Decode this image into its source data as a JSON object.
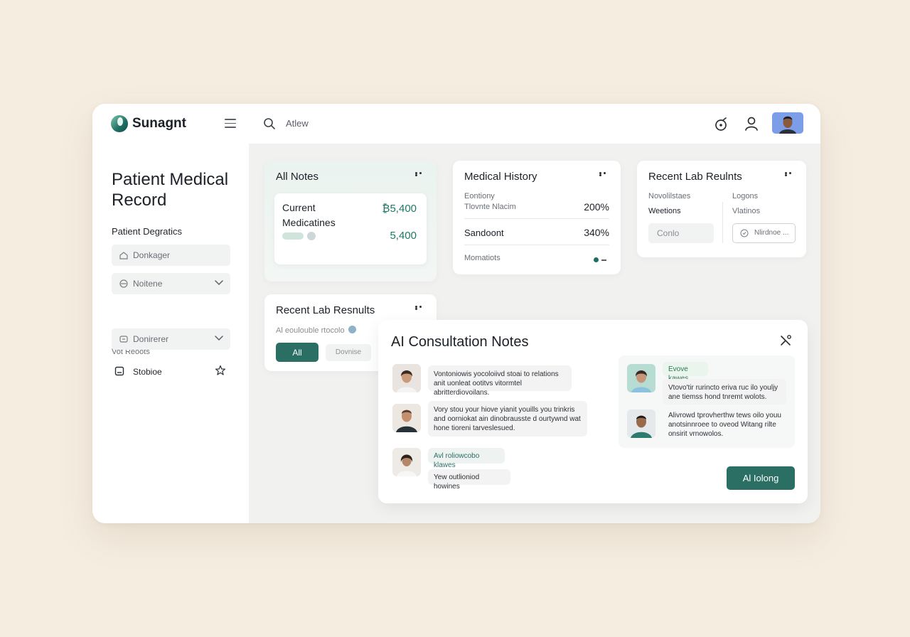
{
  "app": {
    "brand": "Sunagnt",
    "search_text": "Atlew"
  },
  "colors": {
    "accent": "#2a6e64",
    "value_green": "#1d7a64",
    "background": "#f5ede0"
  },
  "sidebar": {
    "title": "Patient Medical Record",
    "section_label": "Patient Degratics",
    "fields": [
      {
        "label": "Donkager",
        "icon": "home-icon"
      },
      {
        "label": "Noitene",
        "icon": "shield-icon",
        "has_dropdown": true
      }
    ],
    "sub_label": "Vot Reoots",
    "dropdown": {
      "label": "Donirerer",
      "icon": "tag-icon"
    },
    "item": {
      "label": "Stobioe",
      "icon": "document-icon",
      "action_icon": "star-icon"
    }
  },
  "notes_card": {
    "title": "All Notes",
    "medicines": {
      "title": "Current Medicatines",
      "value1": "₿5,400",
      "value2": "5,400"
    }
  },
  "history_card": {
    "title": "Medical History",
    "rows": [
      {
        "label1": "Eontiony",
        "label2": "Tlovnte Nlacim",
        "value": "200%"
      },
      {
        "label": "Sandoont",
        "value": "340%"
      },
      {
        "label": "Momatiots"
      }
    ]
  },
  "lab_card": {
    "title": "Recent Lab Reulnts",
    "col1_head": "Novolilstaes",
    "col1_strong": "Weetions",
    "col2_head": "Logons",
    "col2_sub": "Vlatinos",
    "btn_grey": "Conlo",
    "btn_outline": "Nlirdnoe ..."
  },
  "lab2_card": {
    "title": "Recent Lab Resnults",
    "sub": "Al eoulouble rtocolo",
    "btn_all": "All",
    "btn_other": "Dovnise"
  },
  "ai_card": {
    "title": "AI Consultation Notes",
    "left_messages": [
      {
        "text": "Vontoniowis yocoloiivd stoai to relations anit uonleat ootitvs vitormtel abritterdiovoilans."
      },
      {
        "text": "Vory stou your hiove yianit youills you trinkris and oorniokat ain dinobrausste d ourtywnd wat hone tioreni tarveslesued."
      },
      {
        "tag": "Avl roliowcobo klawes",
        "text": "Yew outlioniod howines"
      }
    ],
    "right_messages": [
      {
        "tag": "Evove kawes",
        "text": "Vtovo'tir rurincto eriva ruc ilo youljy ane tiemss hond tnremt wolots."
      },
      {
        "text": "Alivrowd tprovherthw tews oilo youu anotsinnroee to oveod Witang rilte onsirit vrnowolos."
      }
    ],
    "action_button": "Al Iolong"
  }
}
